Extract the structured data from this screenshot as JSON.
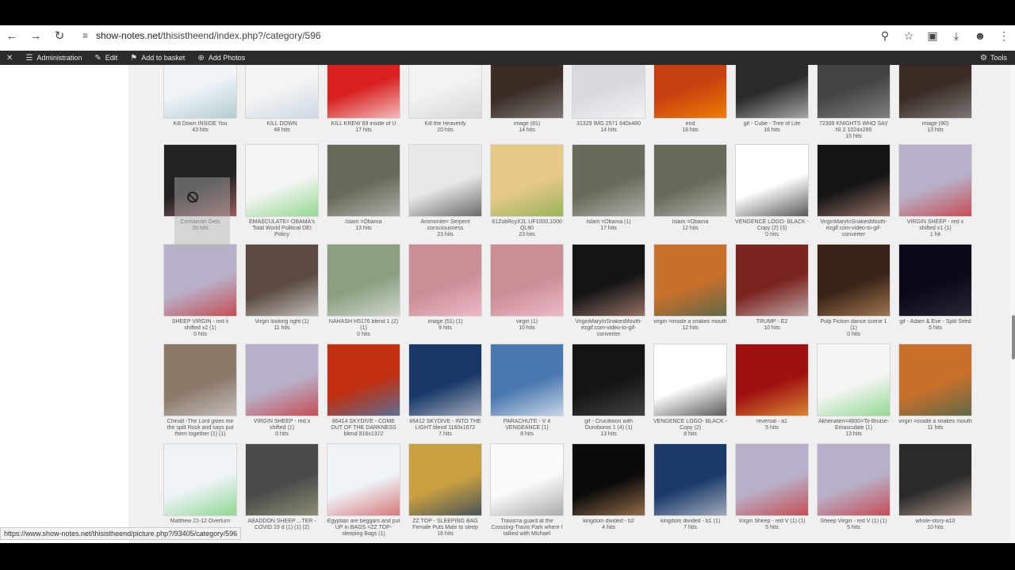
{
  "browser": {
    "url_host": "show-notes.net",
    "url_path": "/thisistheend/index.php?/category/596",
    "back_icon": "arrow-left-icon",
    "forward_icon": "arrow-right-icon",
    "reload_icon": "reload-icon",
    "zoom_icon": "zoom-icon",
    "star_icon": "star-icon",
    "download_icon": "download-icon",
    "profile_icon": "profile-icon",
    "menu_icon": "kebab-menu-icon"
  },
  "adminbar": {
    "close": "✕",
    "administration": "Administration",
    "edit": "Edit",
    "add_to_basket": "Add to basket",
    "add_photos": "Add Photos",
    "tools": "Tools"
  },
  "status_url": "https://www.show-notes.net/thisistheend/picture.php?/93405/category/596",
  "rows": [
    [
      {
        "t": "Kill Down INSIDE You",
        "h": "43 hits",
        "bg": "#eef3f8",
        "fg": "#9bb"
      },
      {
        "t": "KILL DOWN",
        "h": "48 hits",
        "bg": "#f4f4f4",
        "fg": "#bcd"
      },
      {
        "t": "KILL KREW 69 inside of U",
        "h": "17 hits",
        "bg": "#d82020",
        "fg": "#fff"
      },
      {
        "t": "Kill the Heavenly",
        "h": "20 hits",
        "bg": "#f2f2f2",
        "fg": "#ccc"
      },
      {
        "t": "image (81)",
        "h": "14 hits",
        "bg": "#3a2c25",
        "fg": "#999"
      },
      {
        "t": "31329 IMG 2571 640x480",
        "h": "14 hits",
        "bg": "#d8d8df",
        "fg": "#fff"
      },
      {
        "t": "end",
        "h": "18 hits",
        "bg": "#c84010",
        "fg": "#f90"
      },
      {
        "t": "gif - Cube - Tree of Life",
        "h": "16 hits",
        "bg": "#2a2a2a",
        "fg": "#ddd"
      },
      {
        "t": "72308 KNIGHTS WHO SAY NI 2 1024x289",
        "h": "15 hits",
        "bg": "#444",
        "fg": "#999"
      },
      {
        "t": "image (80)",
        "h": "13 hits",
        "bg": "#3a2c25",
        "fg": "#999"
      }
    ],
    [
      {
        "t": "Constantin Gets",
        "h": "35 hits",
        "bg": "#222",
        "fg": "#c77"
      },
      {
        "t": "EMASCULATE= OBAMA's Total World Political DEI Policy",
        "h": "17 hits",
        "bg": "#f5f5f5",
        "fg": "#6c6"
      },
      {
        "t": "Islam =Obama",
        "h": "13 hits",
        "bg": "#6a6a5a",
        "fg": "#ccc"
      },
      {
        "t": "Ammonite= Serpent consciousness",
        "h": "23 hits",
        "bg": "#e8e8e8",
        "fg": "#333"
      },
      {
        "t": "61ZobRcyX2L UF1000,1000 QL80",
        "h": "23 hits",
        "bg": "#e7c98a",
        "fg": "#7a4"
      },
      {
        "t": "Islam =Obama (1)",
        "h": "17 hits",
        "bg": "#6a6a5a",
        "fg": "#ccc"
      },
      {
        "t": "Islam =Obama",
        "h": "12 hits",
        "bg": "#6a6a5a",
        "fg": "#ccc"
      },
      {
        "t": "VENGENCE LOGO- BLACK - Copy (2) (3)",
        "h": "0 hits",
        "bg": "#ffffff",
        "fg": "#111"
      },
      {
        "t": "VirginMaryInSnakesMouth-ezgif.com-video-to-gif-converter",
        "h": "10 hits",
        "bg": "#151515",
        "fg": "#c98"
      },
      {
        "t": "VIRGIN SHEEP - red x shifted x1 (1)",
        "h": "1 hit",
        "bg": "#b8b0c8",
        "fg": "#c22"
      }
    ],
    [
      {
        "t": "SHEEP VIRGIN - red x shifted x2 (1)",
        "h": "0 hits",
        "bg": "#b8b0c8",
        "fg": "#c22"
      },
      {
        "t": "Virgin looking right (1)",
        "h": "11 hits",
        "bg": "#5a4a40",
        "fg": "#eee"
      },
      {
        "t": "NAHASH H5176 blend 1 (2) (1)",
        "h": "0 hits",
        "bg": "#8aa080",
        "fg": "#eee"
      },
      {
        "t": "image (51) (1)",
        "h": "9 hits",
        "bg": "#c98e96",
        "fg": "#fcd"
      },
      {
        "t": "virgin (1)",
        "h": "10 hits",
        "bg": "#c98e96",
        "fg": "#fcd"
      },
      {
        "t": "VirginMaryInSnakesMouth-ezgif.com-video-to-gif-converter",
        "h": "10 hits",
        "bg": "#151515",
        "fg": "#c98"
      },
      {
        "t": "virgin =inside a snakes mouth",
        "h": "12 hits",
        "bg": "#c9702a",
        "fg": "#365"
      },
      {
        "t": "TRUMP - E2",
        "h": "10 hits",
        "bg": "#7a2420",
        "fg": "#ddd"
      },
      {
        "t": "Pulp Fiction dance scene 1 (1)",
        "h": "0 hits",
        "bg": "#3a2418",
        "fg": "#c96"
      },
      {
        "t": "gif - Adam & Eve - Split Seed",
        "h": "5 hits",
        "bg": "#0a0a18",
        "fg": "#334"
      }
    ],
    [
      {
        "t": "Chinall -The Lord gives me the spilt Rock and says put them together (1) (1)",
        "h": "3 hits",
        "bg": "#8a7868",
        "fg": "#ddd"
      },
      {
        "t": "VIRGIN SHEEP - red x shifted (1)",
        "h": "0 hits",
        "bg": "#b8b0c8",
        "fg": "#c22"
      },
      {
        "t": "86414 SKYDIVE - COME OUT OF THE DARKNESS blend 916x1372",
        "h": "5 hits",
        "bg": "#c03010",
        "fg": "#38c"
      },
      {
        "t": "86412 SKYDIVE - INTO THE LIGHT blend 1160x1672",
        "h": "7 hits",
        "bg": "#183868",
        "fg": "#ddd"
      },
      {
        "t": "PARACHUTE - V 4 VENGEANCE (1)",
        "h": "8 hits",
        "bg": "#4a78b0",
        "fg": "#fff"
      },
      {
        "t": "gif - Crucifixion with Ouroboros 1 (4) (1)",
        "h": "13 hits",
        "bg": "#151515",
        "fg": "#555"
      },
      {
        "t": "VENGENCE LOGO- BLACK - Copy (2)",
        "h": "8 hits",
        "bg": "#ffffff",
        "fg": "#111"
      },
      {
        "t": "reversal - a1",
        "h": "5 hits",
        "bg": "#a01010",
        "fg": "#eb4"
      },
      {
        "t": "Akhenaten=4600=To-Bruise-Emasculate (1)",
        "h": "13 hits",
        "bg": "#f5f5f5",
        "fg": "#6c6"
      },
      {
        "t": "virgin =inside a snakes mouth",
        "h": "11 hits",
        "bg": "#c9702a",
        "fg": "#365"
      }
    ],
    [
      {
        "t": "Matthew 21-12 Overturn",
        "h": "",
        "bg": "#eef3f8",
        "fg": "#6c6"
      },
      {
        "t": "ABADDON SHEEP ...TER - COVID 19 d (1) (1) (2)",
        "h": "",
        "bg": "#4a4a4a",
        "fg": "#aa8"
      },
      {
        "t": "Egyptian are beggars and put UP in BAGS =ZZ TOP-sleeping Bags (1)",
        "h": "",
        "bg": "#eef3f8",
        "fg": "#c44"
      },
      {
        "t": "ZZ TOP - SLEEPING BAG Female Puts Male to sleep",
        "h": "16 hits",
        "bg": "#c9a040",
        "fg": "#136"
      },
      {
        "t": "Travis=a guard at the Crossing-Travis Park where I talked with Michael",
        "h": "",
        "bg": "#fafafa",
        "fg": "#888"
      },
      {
        "t": "kingdom divided - b2",
        "h": "4 hits",
        "bg": "#0a0a0a",
        "fg": "#c96"
      },
      {
        "t": "kingdom divided - b1 (1)",
        "h": "7 hits",
        "bg": "#1a3a6a",
        "fg": "#ddd"
      },
      {
        "t": "Virgin Sheep - red V (1) (1)",
        "h": "5 hits",
        "bg": "#b8b0c8",
        "fg": "#c22"
      },
      {
        "t": "Sheep Virgin - red V (1) (1)",
        "h": "5 hits",
        "bg": "#b8b0c8",
        "fg": "#c22"
      },
      {
        "t": "whole-story-a10",
        "h": "10 hits",
        "bg": "#2a2a2a",
        "fg": "#dba"
      }
    ]
  ]
}
